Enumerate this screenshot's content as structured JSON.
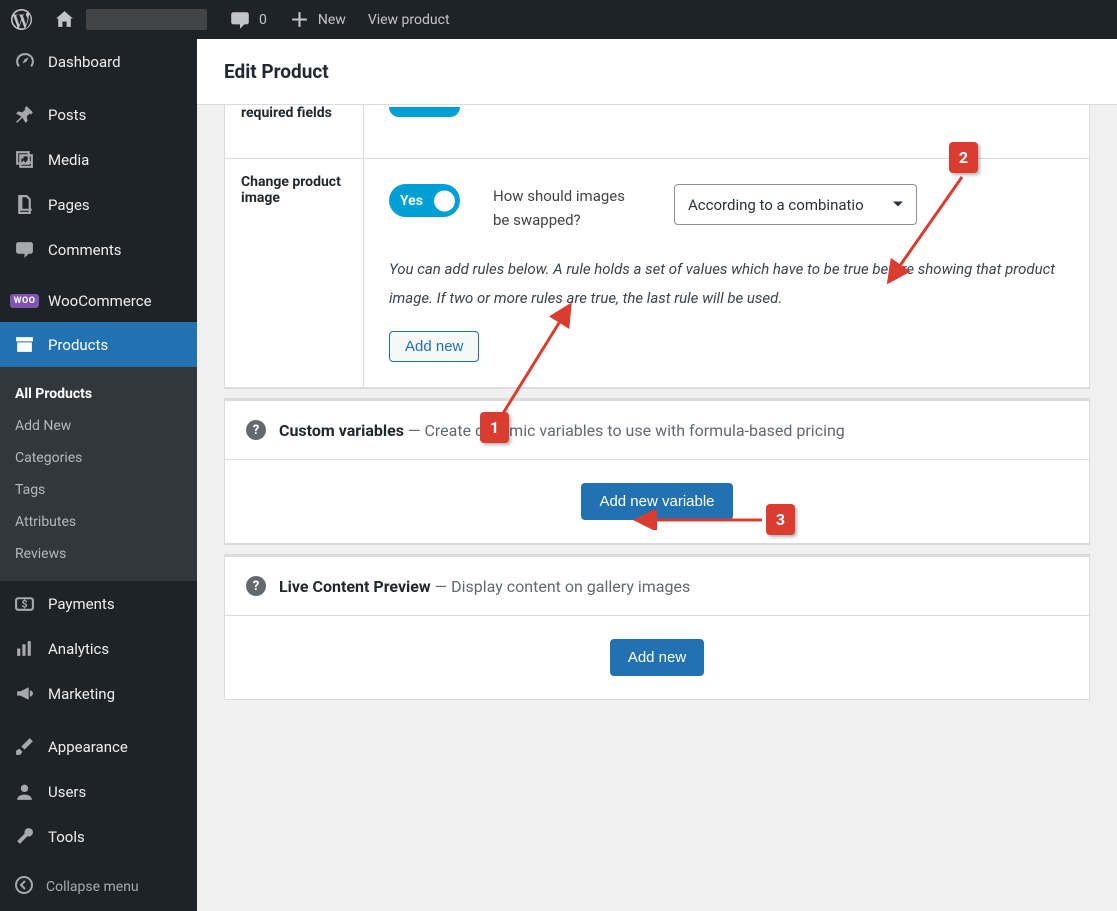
{
  "adminbar": {
    "comment_count": "0",
    "new_label": "New",
    "view_product_label": "View product"
  },
  "sidebar": {
    "items": [
      {
        "label": "Dashboard",
        "icon": "dashboard"
      },
      {
        "label": "Posts",
        "icon": "posts"
      },
      {
        "label": "Media",
        "icon": "media"
      },
      {
        "label": "Pages",
        "icon": "pages"
      },
      {
        "label": "Comments",
        "icon": "comments"
      },
      {
        "label": "WooCommerce",
        "icon": "woo"
      },
      {
        "label": "Products",
        "icon": "products"
      },
      {
        "label": "Payments",
        "icon": "payments"
      },
      {
        "label": "Analytics",
        "icon": "analytics"
      },
      {
        "label": "Marketing",
        "icon": "marketing"
      },
      {
        "label": "Appearance",
        "icon": "appearance"
      },
      {
        "label": "Users",
        "icon": "users"
      },
      {
        "label": "Tools",
        "icon": "tools"
      }
    ],
    "products_submenu": [
      {
        "label": "All Products",
        "active": true
      },
      {
        "label": "Add New"
      },
      {
        "label": "Categories"
      },
      {
        "label": "Tags"
      },
      {
        "label": "Attributes"
      },
      {
        "label": "Reviews"
      }
    ],
    "collapse_label": "Collapse menu"
  },
  "page": {
    "title": "Edit Product",
    "partial_row_label": "required fields",
    "change_image_row_label": "Change product image",
    "toggle_label": "Yes",
    "swap_question": "How should images be swapped?",
    "swap_select_value": "According to a combinatio",
    "rules_hint": "You can add rules below. A rule holds a set of values which have to be true before showing that product image. If two or more rules are true, the last rule will be used.",
    "add_new_rule_btn": "Add new",
    "custom_vars_title": "Custom variables",
    "custom_vars_sub": "Create dynamic variables to use with formula-based pricing",
    "add_var_btn": "Add new variable",
    "live_preview_title": "Live Content Preview",
    "live_preview_sub": "Display content on gallery images",
    "add_new_preview_btn": "Add new"
  },
  "markers": {
    "m1": "1",
    "m2": "2",
    "m3": "3"
  }
}
